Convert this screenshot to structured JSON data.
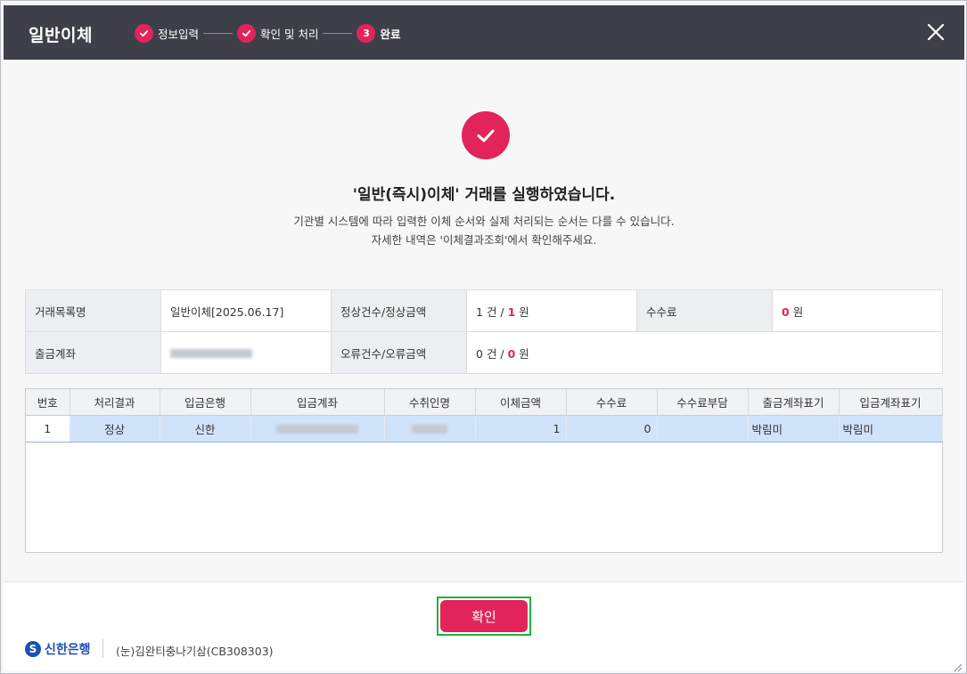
{
  "dialog": {
    "title": "일반이체",
    "close_icon": "close-icon"
  },
  "steps": [
    {
      "label": "정보입력",
      "state": "done"
    },
    {
      "label": "확인 및 처리",
      "state": "done"
    },
    {
      "label": "완료",
      "number": "3",
      "state": "current"
    }
  ],
  "result": {
    "title": "'일반(즉시)이체' 거래를 실행하였습니다.",
    "line1": "기관별 시스템에 따라 입력한 이체 순서와 실제 처리되는 순서는 다를 수 있습니다.",
    "line2": "자세한 내역은 '이체결과조회'에서 확인해주세요."
  },
  "summary": {
    "list_name_label": "거래목록명",
    "list_name_value": "일반이체[2025.06.17]",
    "normal_label": "정상건수/정상금액",
    "normal_count": "1",
    "normal_amount": "1",
    "count_unit": "건 /",
    "won_unit": "원",
    "fee_label": "수수료",
    "fee_value": "0",
    "withdraw_label": "출금계좌",
    "error_label": "오류건수/오류금액",
    "error_count": "0",
    "error_amount": "0"
  },
  "table": {
    "headers": [
      "번호",
      "처리결과",
      "입금은행",
      "입금계좌",
      "수취인명",
      "이체금액",
      "수수료",
      "수수료부담",
      "출금계좌표기",
      "입금계좌표기"
    ],
    "rows": [
      {
        "no": "1",
        "status": "정상",
        "bank": "신한",
        "amount": "1",
        "fee": "0",
        "fee_payer": "",
        "out_memo": "박림미",
        "in_memo": "박림미"
      }
    ]
  },
  "footer": {
    "confirm_label": "확인",
    "bank_name": "신한은행",
    "bank_mark": "S",
    "user_info": "(눈)김완티충나기삼(CB308303)"
  },
  "colors": {
    "accent": "#e2245a",
    "header_bg": "#3d4049",
    "selected_row": "#cfe3fb",
    "bank_blue": "#1b4fb0"
  }
}
